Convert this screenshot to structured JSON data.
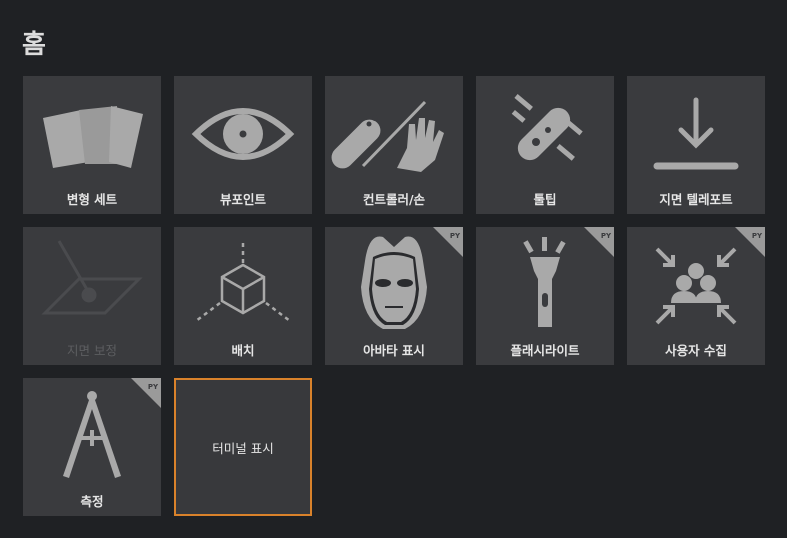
{
  "page": {
    "title": "홈"
  },
  "tiles": [
    {
      "label": "변형 세트",
      "icon": "cards-icon",
      "py": false,
      "disabled": false
    },
    {
      "label": "뷰포인트",
      "icon": "eye-icon",
      "py": false,
      "disabled": false
    },
    {
      "label": "컨트롤러/손",
      "icon": "controller-hand-icon",
      "py": false,
      "disabled": false
    },
    {
      "label": "툴팁",
      "icon": "tooltip-controller-icon",
      "py": false,
      "disabled": false
    },
    {
      "label": "지면 텔레포트",
      "icon": "teleport-down-icon",
      "py": false,
      "disabled": false
    },
    {
      "label": "지면 보정",
      "icon": "ground-plane-icon",
      "py": false,
      "disabled": true
    },
    {
      "label": "배치",
      "icon": "cube-placement-icon",
      "py": false,
      "disabled": false
    },
    {
      "label": "아바타 표시",
      "icon": "avatar-face-icon",
      "py": true,
      "disabled": false
    },
    {
      "label": "플래시라이트",
      "icon": "flashlight-icon",
      "py": true,
      "disabled": false
    },
    {
      "label": "사용자 수집",
      "icon": "gather-users-icon",
      "py": true,
      "disabled": false
    },
    {
      "label": "측정",
      "icon": "compass-icon",
      "py": true,
      "disabled": false
    },
    {
      "label": "터미널 표시",
      "icon": "",
      "py": false,
      "disabled": false,
      "selected": true
    }
  ],
  "badge_text": "PY",
  "colors": {
    "background": "#1f2124",
    "tile": "#3a3b3e",
    "icon": "#a9a9a9",
    "selected_border": "#d9822b"
  }
}
